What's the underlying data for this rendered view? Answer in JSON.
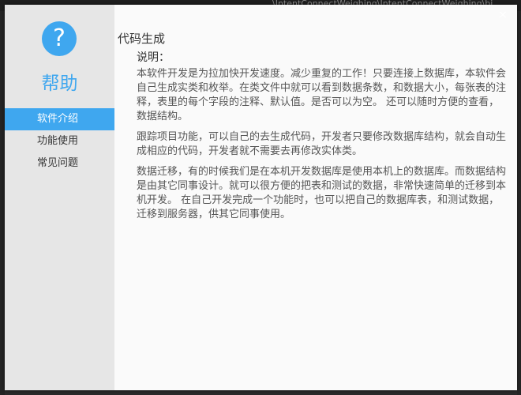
{
  "background": {
    "path_text": "\\IntentConnectWeighing\\IntentConnectWeighing\\bi"
  },
  "dialog": {
    "help_icon_glyph": "?",
    "help_title": "帮助",
    "close_glyph": "×",
    "nav": [
      {
        "label": "软件介绍",
        "active": true
      },
      {
        "label": "功能使用",
        "active": false
      },
      {
        "label": "常见问题",
        "active": false
      }
    ],
    "content": {
      "section_title": "代码生成",
      "sub_title": "说明：",
      "paragraphs": [
        "本软件开发是为拉加快开发速度。减少重复的工作！只要连接上数据库，本软件会自己生成实类和枚举。在类文件中就可以看到数据条数，和数据大小，每张表的注释，表里的每个字段的注释、默认值。是否可以为空。 还可以随时方便的查看，数据结构。",
        "跟踪项目功能，可以自己的去生成代码，开发者只要修改数据库结构，就会自动生成相应的代码，开发者就不需要去再修改实体类。",
        "数据迁移，有的时候我们是在本机开发数据库是使用本机上的数据库。而数据结构是由其它同事设计。就可以很方便的把表和测试的数据，非常快速简单的迁移到本机开发。 在自己开发完成一个功能时，也可以把自己的数据库表，和测试数据，迁移到服务器，供其它同事使用。"
      ]
    }
  },
  "colors": {
    "accent": "#3fa7ef",
    "sidebar_bg": "#e6e6e6",
    "content_bg": "#fafafa"
  }
}
